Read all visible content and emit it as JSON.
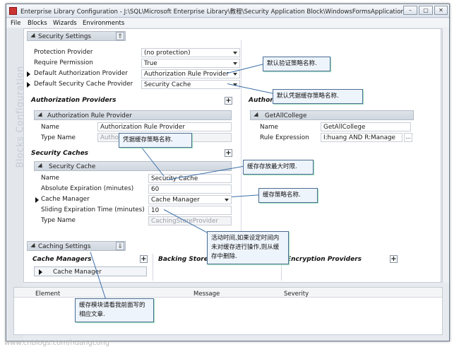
{
  "window": {
    "title": "Enterprise Library Configuration - J:\\SQL\\Microsoft Enterprise Library\\教程\\Security Application Block\\WindowsFormsApplication..."
  },
  "menu": [
    "File",
    "Blocks",
    "Wizards",
    "Environments"
  ],
  "sidebar": {
    "vertical_label": "Blocks Configuration"
  },
  "security_settings": {
    "header": "Security Settings",
    "rows": [
      {
        "label": "Protection Provider",
        "value": "(no protection)",
        "dropdown": true
      },
      {
        "label": "Require Permission",
        "value": "True",
        "dropdown": true
      },
      {
        "label": "Default Authorization Provider",
        "value": "Authorization Rule Provider",
        "dropdown": true
      },
      {
        "label": "Default Security Cache Provider",
        "value": "Security Cache",
        "dropdown": true
      }
    ]
  },
  "authorization_providers": {
    "title": "Authorization Providers",
    "item_header": "Authorization Rule Provider",
    "rows": [
      {
        "label": "Name",
        "value": "Authorization Rule Provider"
      },
      {
        "label": "Type Name",
        "value": "Author"
      }
    ]
  },
  "authorization_rules": {
    "title": "Authoriza",
    "item_header": "GetAllCollege",
    "rows": [
      {
        "label": "Name",
        "value": "GetAllCollege"
      },
      {
        "label": "Rule Expression",
        "value": "I:huang AND  R:Manage"
      }
    ],
    "ellipsis": "..."
  },
  "security_caches": {
    "title": "Security Caches",
    "item_header": "Security Cache",
    "rows": [
      {
        "label": "Name",
        "value": "Security Cache"
      },
      {
        "label": "Absolute Expiration (minutes)",
        "value": "60"
      },
      {
        "label": "Cache Manager",
        "value": "Cache Manager"
      },
      {
        "label": "Sliding Expiration Time (minutes)",
        "value": "10"
      },
      {
        "label": "Type Name",
        "value": "CachingStoreProvider"
      }
    ]
  },
  "caching_settings": {
    "header": "Caching Settings",
    "cache_managers": "Cache Managers",
    "cache_manager_item": "Cache Manager",
    "backing_stores": "Backing Stores",
    "encryption_providers": "Encryption Providers"
  },
  "bottom_panel": {
    "columns": [
      "Element",
      "Message",
      "Severity"
    ]
  },
  "callouts": {
    "c1": "默认验证策略名称.",
    "c2": "默认凭据缓存策略名称.",
    "c3": "凭据缓存策略名称.",
    "c4": "缓存存放最大时限.",
    "c5": "缓存策略名称.",
    "c6": "活动时间,如果设定时间内未对缓存进行操作,则从缓存中删除.",
    "c7": "缓存模块请看我前面写的相应文章."
  },
  "watermark": "www.cnblogs.com/huangcong",
  "colors": {
    "callout_border": "#4a6d93",
    "header_bg": "#cfd6df",
    "accent": "#3a6ea8"
  }
}
